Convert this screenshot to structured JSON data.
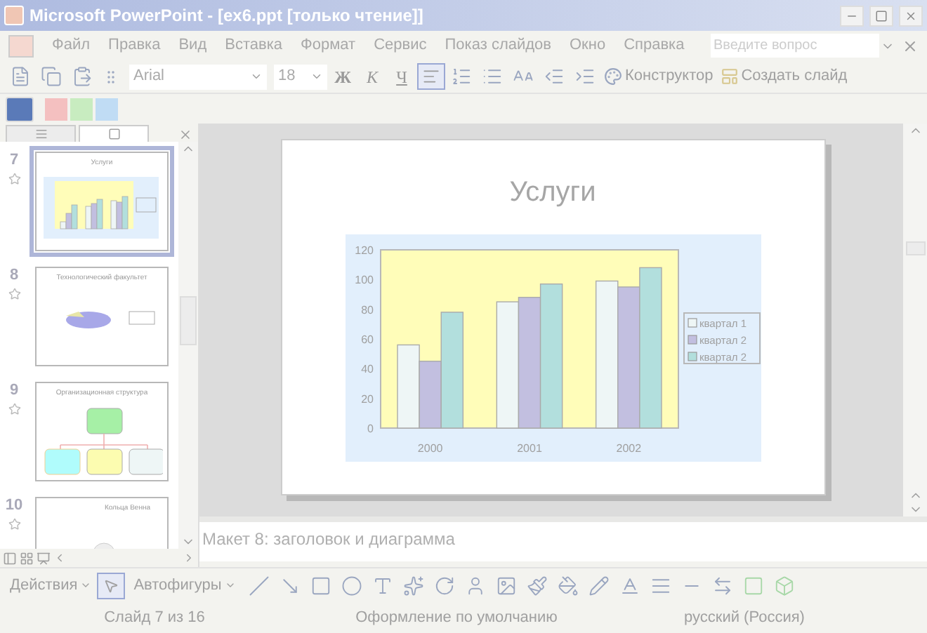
{
  "window": {
    "title": "Microsoft PowerPoint - [ex6.ppt [только чтение]]"
  },
  "menu": [
    "Файл",
    "Правка",
    "Вид",
    "Вставка",
    "Формат",
    "Сервис",
    "Показ слайдов",
    "Окно",
    "Справка"
  ],
  "help_search": {
    "placeholder": "Введите вопрос"
  },
  "formatting_toolbar": {
    "font": "Arial",
    "size": "18",
    "bold": "Ж",
    "italic": "К",
    "underline": "Ч",
    "align_left": {
      "selected": true
    },
    "designer": "Конструктор",
    "new_slide": "Создать слайд"
  },
  "slide_panel": {
    "tabs": [
      {
        "kind": "outline",
        "selected": false
      },
      {
        "kind": "slides",
        "selected": true
      }
    ],
    "thumbnails": [
      {
        "number": "7",
        "title": "Услуги",
        "kind": "chart",
        "selected": true
      },
      {
        "number": "8",
        "title": "Технологический факультет",
        "kind": "pie",
        "selected": false
      },
      {
        "number": "9",
        "title": "Организационная структура",
        "kind": "org",
        "selected": false
      },
      {
        "number": "10",
        "title": "Кольца Венна",
        "kind": "venn",
        "selected": false
      }
    ]
  },
  "slide": {
    "title": "Услуги",
    "chart_data": {
      "type": "bar",
      "categories": [
        "2000",
        "2001",
        "2002"
      ],
      "series": [
        {
          "name": "квартал 1",
          "color": "#eef6f6",
          "values": [
            56,
            85,
            99
          ]
        },
        {
          "name": "квартал 2",
          "color": "#c2bfe0",
          "values": [
            45,
            88,
            95
          ]
        },
        {
          "name": "квартал 2",
          "color": "#b2dfdd",
          "values": [
            78,
            97,
            108
          ]
        }
      ],
      "ylim": [
        0,
        120
      ],
      "yticks": [
        0,
        20,
        40,
        60,
        80,
        100,
        120
      ],
      "legend": true
    }
  },
  "notes": {
    "text": "Макет 8: заголовок и диаграмма"
  },
  "drawing_toolbar": {
    "actions": "Действия",
    "autoshapes": "Автофигуры"
  },
  "status_bar": [
    "Слайд 7 из 16",
    "Оформление по умолчанию",
    "русский (Россия)"
  ]
}
